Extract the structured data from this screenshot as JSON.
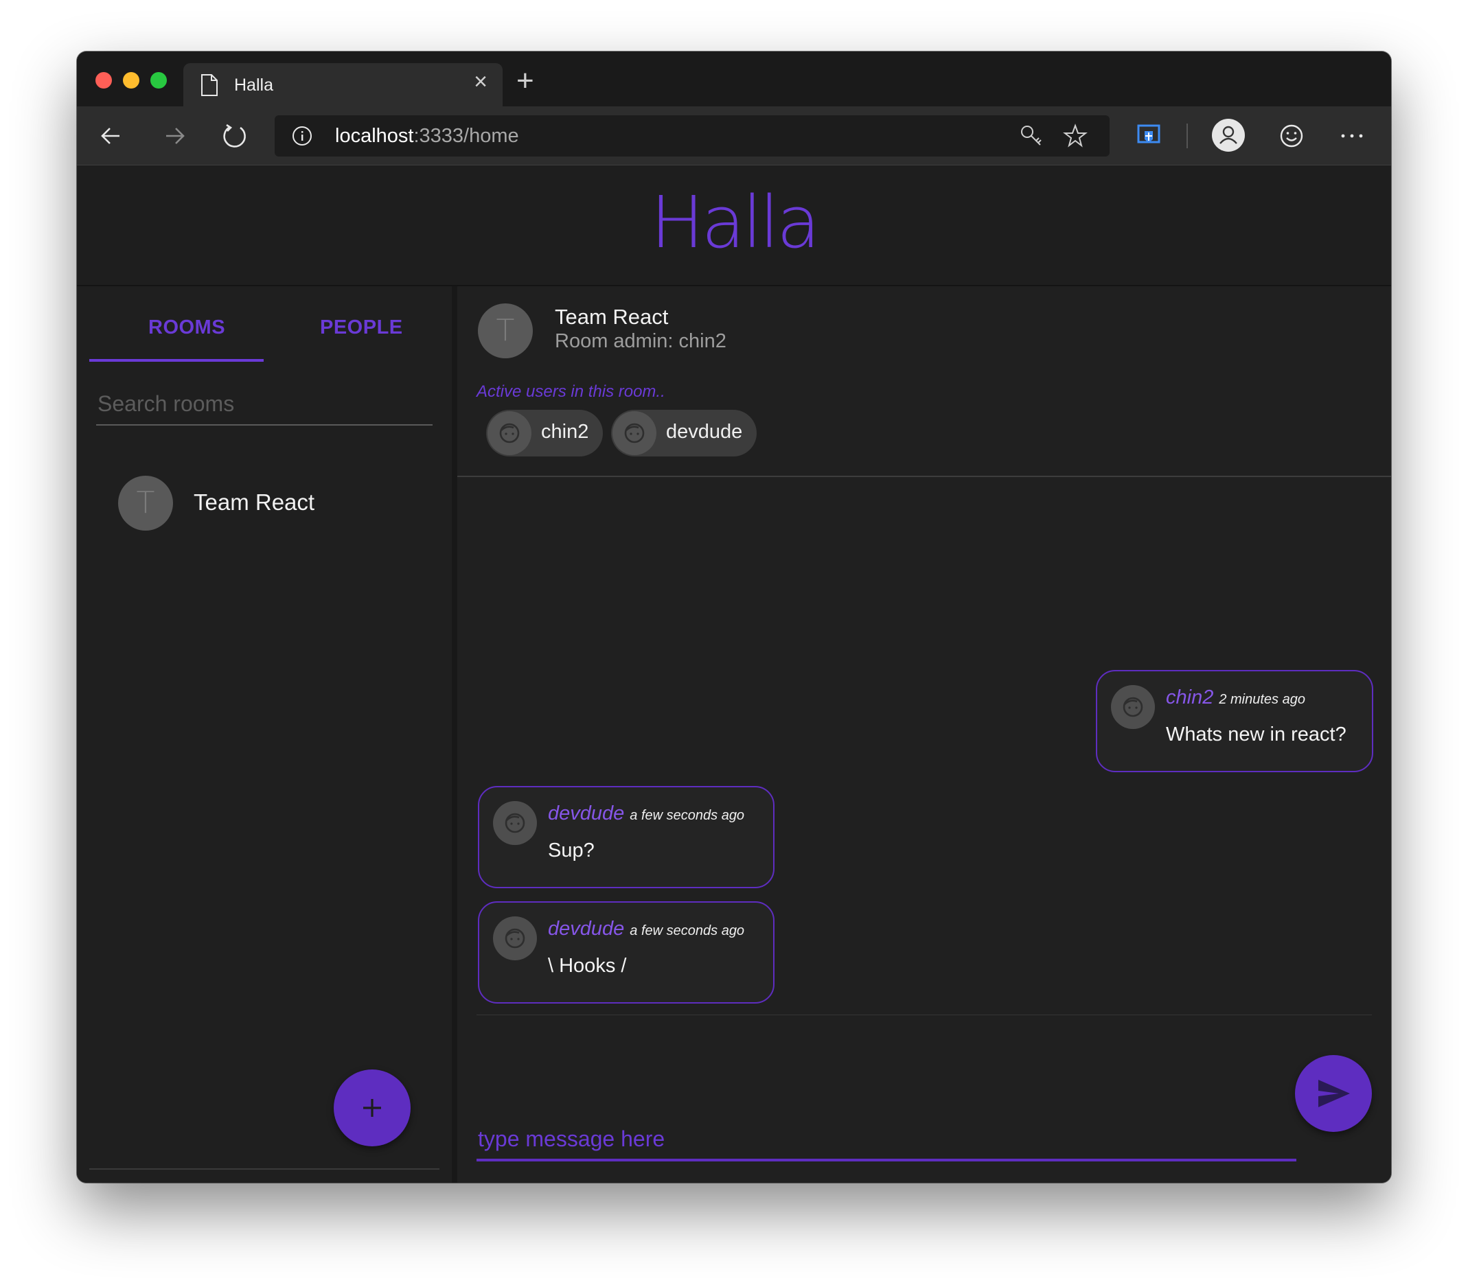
{
  "browser": {
    "tab_title": "Halla",
    "url_host": "localhost",
    "url_rest": ":3333/home"
  },
  "app": {
    "brand": "Halla"
  },
  "sidebar": {
    "tabs": [
      {
        "label": "ROOMS"
      },
      {
        "label": "PEOPLE"
      }
    ],
    "search_placeholder": "Search rooms",
    "rooms": [
      {
        "initial": "T",
        "name": "Team React"
      }
    ]
  },
  "room": {
    "initial": "T",
    "title": "Team React",
    "admin": "Room admin: chin2",
    "active_label": "Active users in this room..",
    "active_users": [
      {
        "name": "chin2"
      },
      {
        "name": "devdude"
      }
    ]
  },
  "messages": [
    {
      "user": "chin2",
      "time": "2 minutes ago",
      "text": "Whats new in react?"
    },
    {
      "user": "devdude",
      "time": "a few seconds ago",
      "text": "Sup?"
    },
    {
      "user": "devdude",
      "time": "a few seconds ago",
      "text": "\\ Hooks /"
    }
  ],
  "composer": {
    "placeholder": "type message here"
  },
  "colors": {
    "accent": "#5e2dc0",
    "accent_text": "#6a3ad6",
    "background": "#1f1f1f"
  }
}
